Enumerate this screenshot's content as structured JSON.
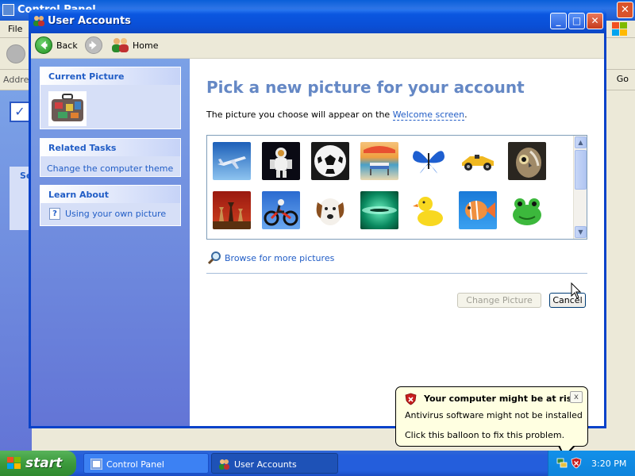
{
  "background_window": {
    "title": "Control Panel",
    "menu_file": "File",
    "address_label": "Address",
    "go_label": "Go",
    "side_label": "See"
  },
  "window": {
    "title": "User Accounts",
    "minimize": "_",
    "maximize": "□",
    "close": "✕"
  },
  "nav": {
    "back_label": "Back",
    "home_label": "Home"
  },
  "sidebar": {
    "current_picture": {
      "header": "Current Picture",
      "icon": "suitcase-icon"
    },
    "related_tasks": {
      "header": "Related Tasks",
      "items": [
        {
          "label": "Change the computer theme"
        }
      ]
    },
    "learn_about": {
      "header": "Learn About",
      "items": [
        {
          "label": "Using your own picture",
          "icon": "help-icon"
        }
      ]
    }
  },
  "main": {
    "title": "Pick a new picture for your account",
    "description_prefix": "The picture you choose will appear on the ",
    "description_link": "Welcome screen",
    "description_suffix": ".",
    "pictures": [
      {
        "name": "airplane"
      },
      {
        "name": "astronaut"
      },
      {
        "name": "soccer-ball"
      },
      {
        "name": "beach-chair"
      },
      {
        "name": "butterfly"
      },
      {
        "name": "race-car"
      },
      {
        "name": "owl"
      },
      {
        "name": "chess"
      },
      {
        "name": "dirt-bike"
      },
      {
        "name": "dog"
      },
      {
        "name": "green-abstract"
      },
      {
        "name": "rubber-duck"
      },
      {
        "name": "fish"
      },
      {
        "name": "frog"
      }
    ],
    "browse_label": "Browse for more pictures",
    "change_button": "Change Picture",
    "cancel_button": "Cancel"
  },
  "taskbar": {
    "start_label": "start",
    "items": [
      {
        "label": "Control Panel"
      },
      {
        "label": "User Accounts"
      }
    ],
    "clock": "3:20 PM"
  },
  "balloon": {
    "title": "Your computer might be at risk",
    "line1": "Antivirus software might not be installed",
    "line2": "Click this balloon to fix this problem.",
    "close": "x"
  },
  "colors": {
    "title_blue": "#0a4fd6",
    "task_pane": "#6375d6",
    "link": "#215dc6",
    "heading": "#6588c5",
    "balloon_bg": "#ffffe1"
  }
}
